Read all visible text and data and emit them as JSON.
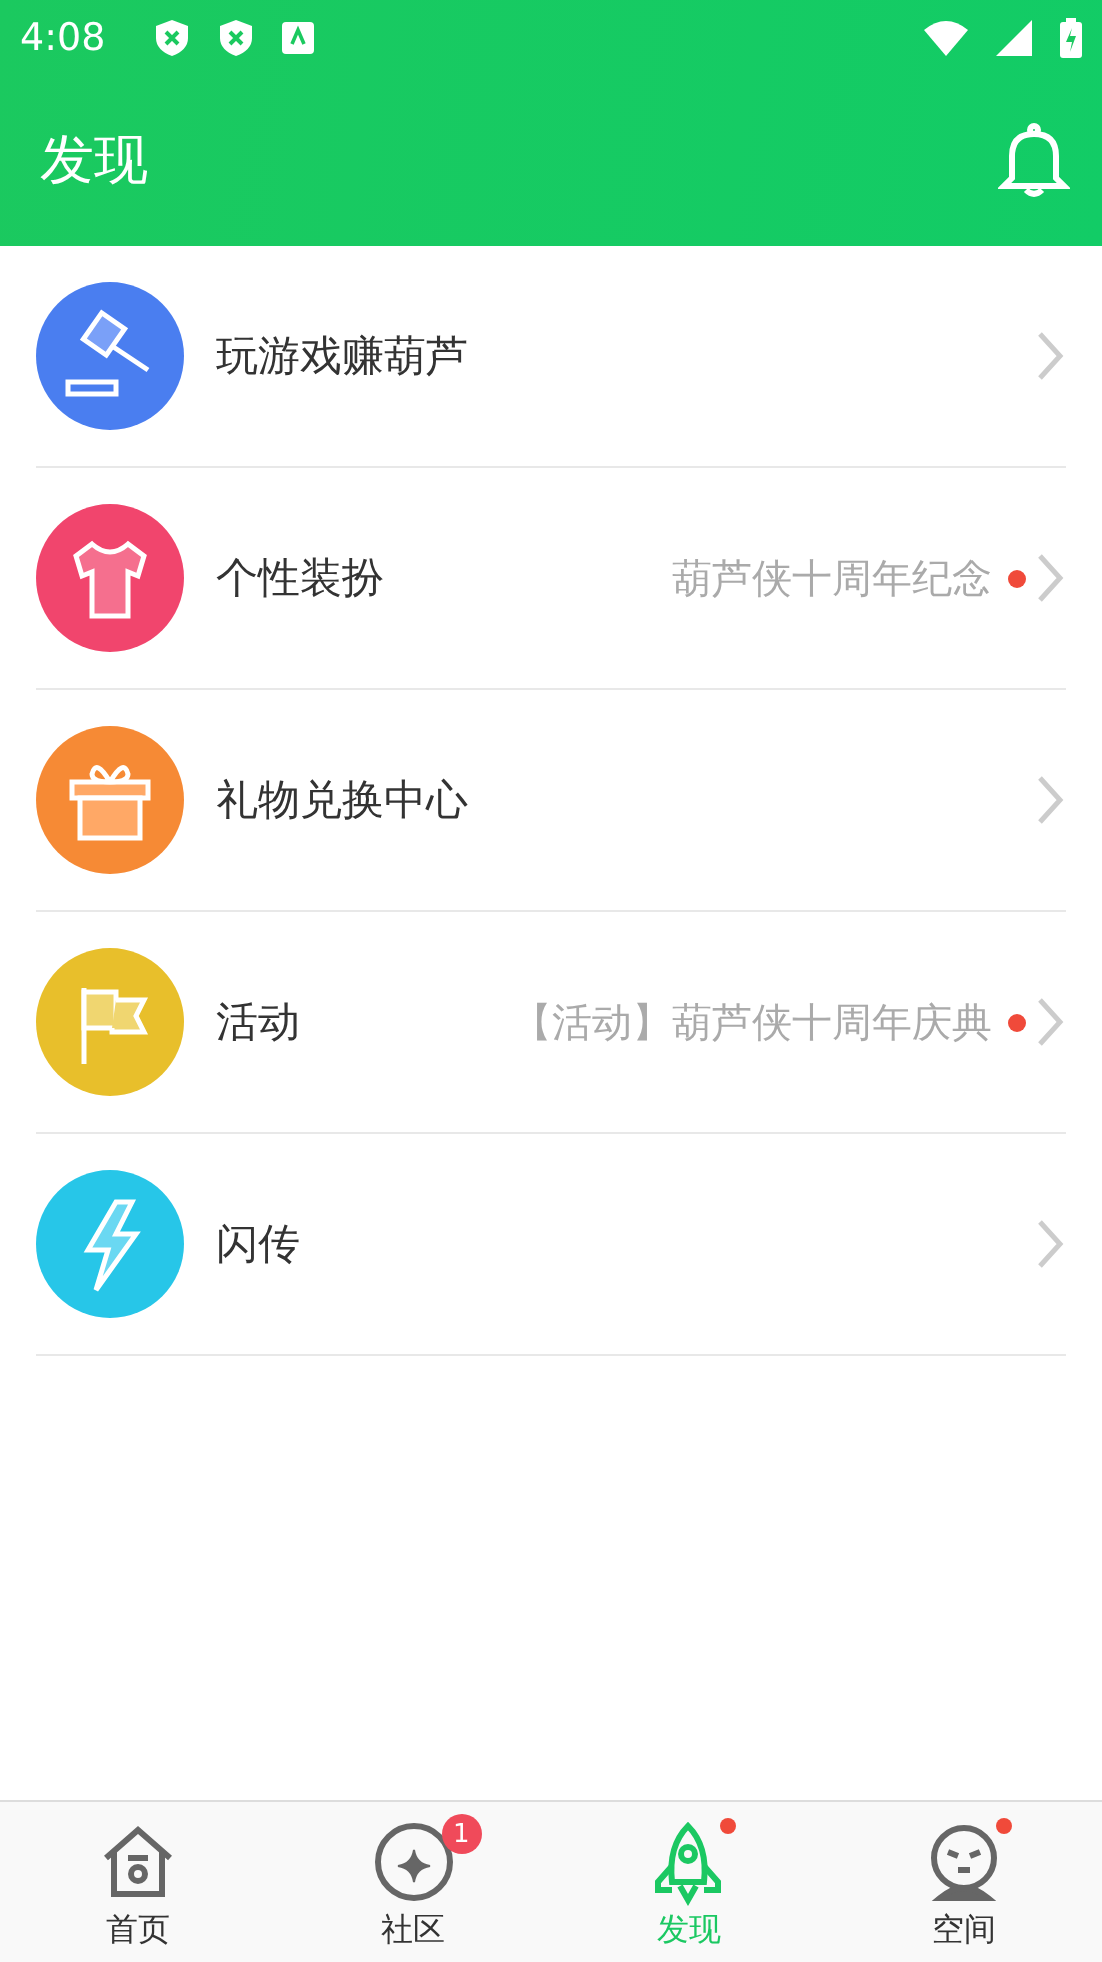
{
  "status_bar": {
    "time": "4:08"
  },
  "app_bar": {
    "title": "发现"
  },
  "items": [
    {
      "kind": "gavel",
      "color": "#4a7ef0",
      "label": "玩游戏赚葫芦",
      "dot": false
    },
    {
      "kind": "shirt",
      "color": "#f1456d",
      "label": "个性装扮",
      "detail": "葫芦侠十周年纪念",
      "dot": true
    },
    {
      "kind": "gift",
      "color": "#f68a35",
      "label": "礼物兑换中心",
      "dot": false
    },
    {
      "kind": "flag",
      "color": "#e8bf2b",
      "label": "活动",
      "detail": "【活动】葫芦侠十周年庆典",
      "dot": true
    },
    {
      "kind": "bolt",
      "color": "#27c6e8",
      "label": "闪传",
      "dot": false
    }
  ],
  "tabs": [
    {
      "kind": "home",
      "label": "首页",
      "selected": false,
      "dot": false
    },
    {
      "kind": "community",
      "label": "社区",
      "selected": false,
      "badge": "1",
      "dot": false
    },
    {
      "kind": "rocket",
      "label": "发现",
      "selected": true,
      "dot": true
    },
    {
      "kind": "space",
      "label": "空间",
      "selected": false,
      "dot": true
    }
  ]
}
